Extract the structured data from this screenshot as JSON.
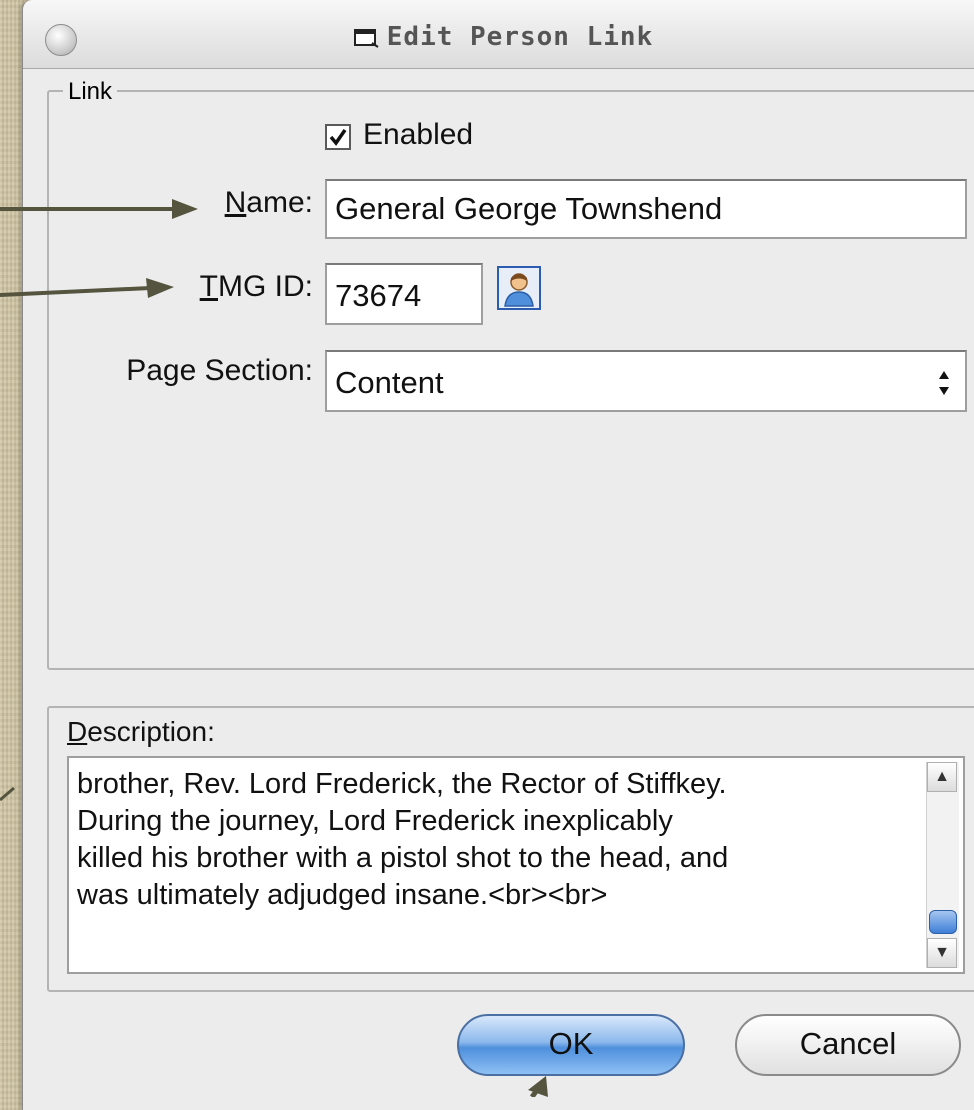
{
  "window": {
    "title": "Edit Person Link"
  },
  "link_group": {
    "legend": "Link",
    "enabled": {
      "label": "Enabled",
      "checked": true
    },
    "name": {
      "label_key": "N",
      "label_rest": "ame:",
      "value": "General George Townshend"
    },
    "tmg_id": {
      "label_key": "T",
      "label_rest": "MG ID:",
      "value": "73674"
    },
    "page_section": {
      "label": "Page Section:",
      "value": "Content"
    }
  },
  "description": {
    "label_key": "D",
    "label_rest": "escription:",
    "lines": [
      "brother, Rev. Lord Frederick, the Rector of Stiffkey.",
      "During the journey, Lord Frederick inexplicably",
      "killed his brother with a pistol shot to the head, and",
      "was ultimately adjudged insane.<br><br>"
    ]
  },
  "buttons": {
    "ok": "OK",
    "cancel": "Cancel"
  },
  "colors": {
    "background": "#cfc4a2",
    "window": "#ececec",
    "annotation_arrow": "#55543f",
    "ok_button": "#6fa2e4"
  },
  "icons": [
    "window-icon",
    "checkmark-icon",
    "person-picker-icon",
    "up-down-arrows-icon",
    "scroll-up-icon",
    "scroll-down-icon"
  ]
}
